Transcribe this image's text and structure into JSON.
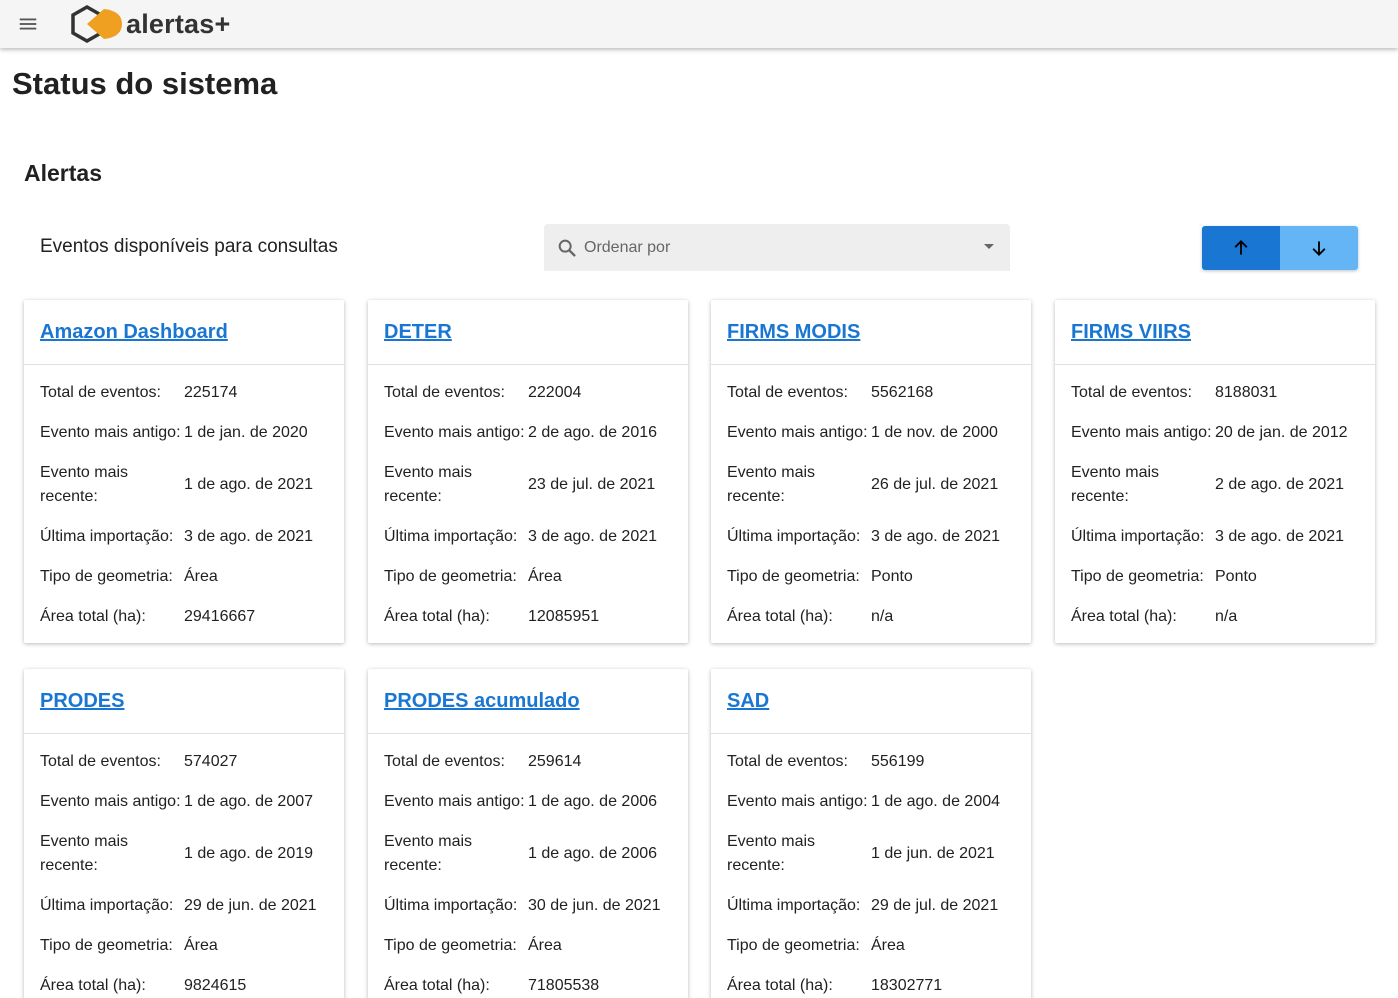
{
  "app": {
    "logo_text": "alertas+"
  },
  "page": {
    "title": "Status do sistema",
    "section": "Alertas",
    "subtitle": "Eventos disponíveis para consultas"
  },
  "sort": {
    "placeholder": "Ordenar por"
  },
  "icons": {
    "menu": "menu-icon",
    "search": "search-icon",
    "asc": "arrow-up-icon",
    "desc": "arrow-down-icon"
  },
  "colors": {
    "primary": "#1976d2",
    "primary_light": "#64b5f6",
    "logo_orange": "#f0a020"
  },
  "labels": {
    "total": "Total de eventos:",
    "oldest": "Evento mais antigo:",
    "newest": "Evento mais recente:",
    "last_import": "Última importação:",
    "geometry": "Tipo de geometria:",
    "area": "Área total (ha):"
  },
  "cards": [
    {
      "title": "Amazon Dashboard",
      "total": "225174",
      "oldest": "1 de jan. de 2020",
      "newest": "1 de ago. de 2021",
      "last_import": "3 de ago. de 2021",
      "geometry": "Área",
      "area": "29416667"
    },
    {
      "title": "DETER",
      "total": "222004",
      "oldest": "2 de ago. de 2016",
      "newest": "23 de jul. de 2021",
      "last_import": "3 de ago. de 2021",
      "geometry": "Área",
      "area": "12085951"
    },
    {
      "title": "FIRMS MODIS",
      "total": "5562168",
      "oldest": "1 de nov. de 2000",
      "newest": "26 de jul. de 2021",
      "last_import": "3 de ago. de 2021",
      "geometry": "Ponto",
      "area": "n/a"
    },
    {
      "title": "FIRMS VIIRS",
      "total": "8188031",
      "oldest": "20 de jan. de 2012",
      "newest": "2 de ago. de 2021",
      "last_import": "3 de ago. de 2021",
      "geometry": "Ponto",
      "area": "n/a"
    },
    {
      "title": "PRODES",
      "total": "574027",
      "oldest": "1 de ago. de 2007",
      "newest": "1 de ago. de 2019",
      "last_import": "29 de jun. de 2021",
      "geometry": "Área",
      "area": "9824615"
    },
    {
      "title": "PRODES acumulado",
      "total": "259614",
      "oldest": "1 de ago. de 2006",
      "newest": "1 de ago. de 2006",
      "last_import": "30 de jun. de 2021",
      "geometry": "Área",
      "area": "71805538"
    },
    {
      "title": "SAD",
      "total": "556199",
      "oldest": "1 de ago. de 2004",
      "newest": "1 de jun. de 2021",
      "last_import": "29 de jul. de 2021",
      "geometry": "Área",
      "area": "18302771"
    }
  ]
}
